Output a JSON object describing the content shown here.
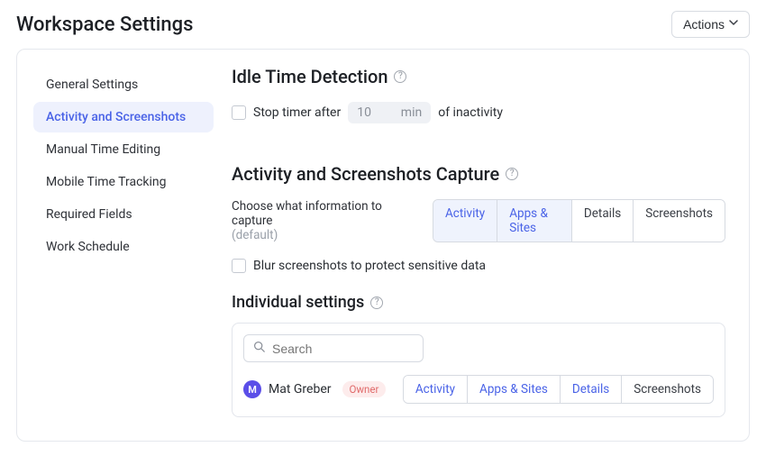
{
  "header": {
    "title": "Workspace Settings",
    "actions_label": "Actions"
  },
  "sidebar": {
    "items": [
      {
        "label": "General Settings"
      },
      {
        "label": "Activity and Screenshots"
      },
      {
        "label": "Manual Time Editing"
      },
      {
        "label": "Mobile Time Tracking"
      },
      {
        "label": "Required Fields"
      },
      {
        "label": "Work Schedule"
      }
    ],
    "active_index": 1
  },
  "idle": {
    "heading": "Idle Time Detection",
    "stop_label": "Stop timer after",
    "value": "10",
    "unit": "min",
    "suffix": "of inactivity"
  },
  "capture": {
    "heading": "Activity and Screenshots Capture",
    "desc_line1": "Choose what information to capture",
    "desc_line2": "(default)",
    "options": [
      "Activity",
      "Apps & Sites",
      "Details",
      "Screenshots"
    ],
    "selected": [
      0,
      1
    ],
    "blur_label": "Blur screenshots to protect sensitive data"
  },
  "individual": {
    "heading": "Individual settings",
    "search_placeholder": "Search",
    "user": {
      "initial": "M",
      "name": "Mat Greber",
      "role": "Owner"
    },
    "options": [
      "Activity",
      "Apps & Sites",
      "Details",
      "Screenshots"
    ],
    "selected": [
      0,
      1,
      2
    ]
  }
}
